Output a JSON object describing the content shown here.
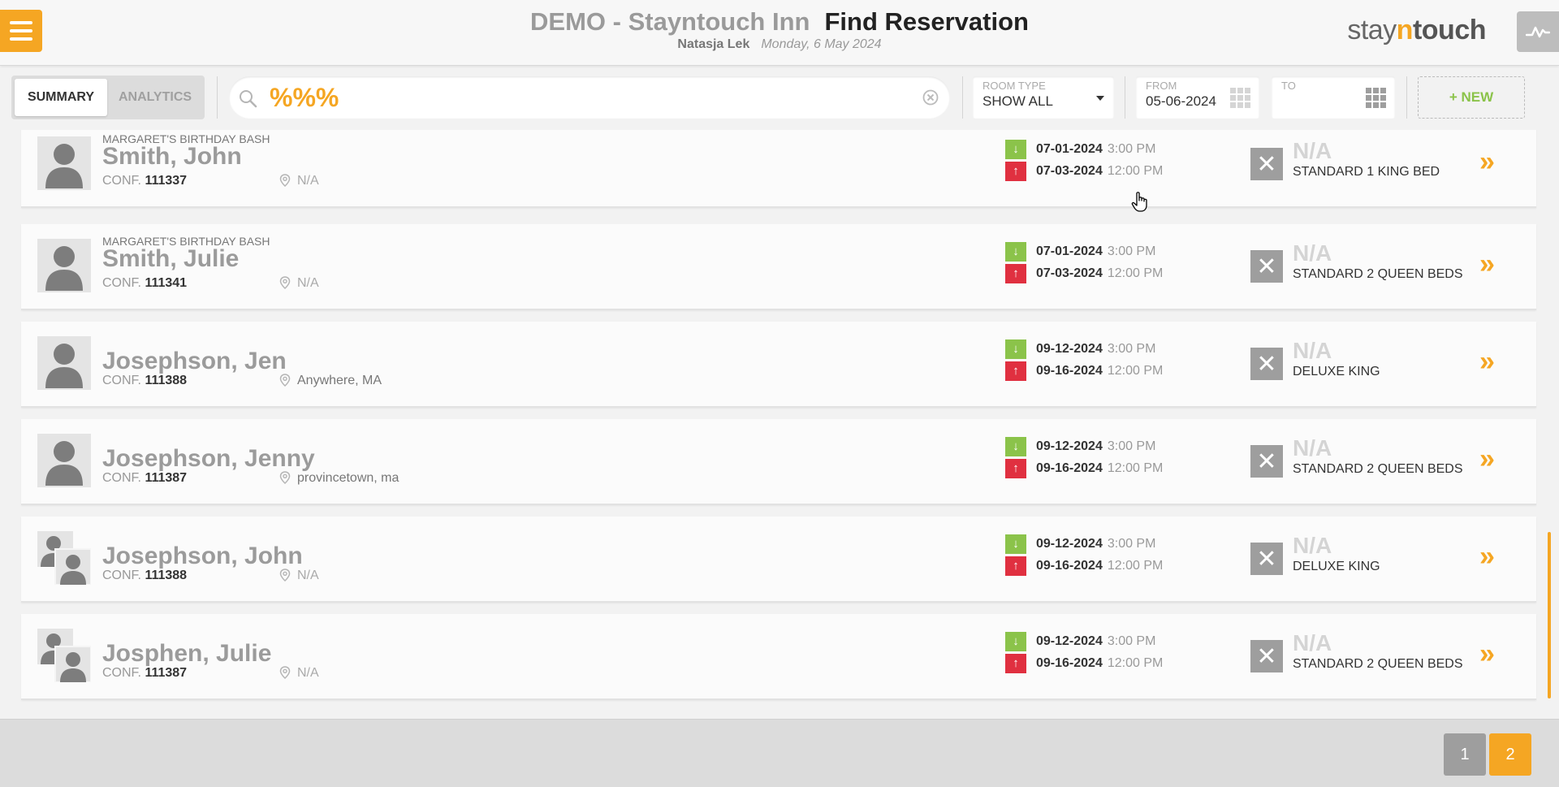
{
  "header": {
    "hotel_name": "DEMO - Stayntouch Inn",
    "page_title": "Find Reservation",
    "user": "Natasja Lek",
    "date": "Monday, 6 May 2024",
    "logo_pre": "stay",
    "logo_n": "n",
    "logo_post": "touch"
  },
  "toolbar": {
    "tabs": [
      {
        "label": "SUMMARY",
        "active": true
      },
      {
        "label": "ANALYTICS",
        "active": false
      }
    ],
    "search_value": "%%%",
    "room_type": {
      "label": "ROOM TYPE",
      "value": "SHOW ALL"
    },
    "from": {
      "label": "FROM",
      "value": "05-06-2024"
    },
    "to": {
      "label": "TO",
      "value": ""
    },
    "new_label": "+ NEW"
  },
  "reservations": [
    {
      "group": "MARGARET'S BIRTHDAY BASH",
      "name": "Smith, John",
      "conf_label": "CONF.",
      "conf": "111337",
      "location": "N/A",
      "arrival_date": "07-01-2024",
      "arrival_time": "3:00 PM",
      "departure_date": "07-03-2024",
      "departure_time": "12:00 PM",
      "room": "N/A",
      "room_type": "STANDARD 1 KING BED",
      "avatar": "single"
    },
    {
      "group": "MARGARET'S BIRTHDAY BASH",
      "name": "Smith, Julie",
      "conf_label": "CONF.",
      "conf": "111341",
      "location": "N/A",
      "arrival_date": "07-01-2024",
      "arrival_time": "3:00 PM",
      "departure_date": "07-03-2024",
      "departure_time": "12:00 PM",
      "room": "N/A",
      "room_type": "STANDARD 2 QUEEN BEDS",
      "avatar": "single"
    },
    {
      "group": "",
      "name": "Josephson, Jen",
      "conf_label": "CONF.",
      "conf": "111388",
      "location": "Anywhere, MA",
      "arrival_date": "09-12-2024",
      "arrival_time": "3:00 PM",
      "departure_date": "09-16-2024",
      "departure_time": "12:00 PM",
      "room": "N/A",
      "room_type": "DELUXE KING",
      "avatar": "single"
    },
    {
      "group": "",
      "name": "Josephson, Jenny",
      "conf_label": "CONF.",
      "conf": "111387",
      "location": "provincetown, ma",
      "arrival_date": "09-12-2024",
      "arrival_time": "3:00 PM",
      "departure_date": "09-16-2024",
      "departure_time": "12:00 PM",
      "room": "N/A",
      "room_type": "STANDARD 2 QUEEN BEDS",
      "avatar": "single"
    },
    {
      "group": "",
      "name": "Josephson, John",
      "conf_label": "CONF.",
      "conf": "111388",
      "location": "N/A",
      "arrival_date": "09-12-2024",
      "arrival_time": "3:00 PM",
      "departure_date": "09-16-2024",
      "departure_time": "12:00 PM",
      "room": "N/A",
      "room_type": "DELUXE KING",
      "avatar": "multiple"
    },
    {
      "group": "",
      "name": "Josphen, Julie",
      "conf_label": "CONF.",
      "conf": "111387",
      "location": "N/A",
      "arrival_date": "09-12-2024",
      "arrival_time": "3:00 PM",
      "departure_date": "09-16-2024",
      "departure_time": "12:00 PM",
      "room": "N/A",
      "room_type": "STANDARD 2 QUEEN BEDS",
      "avatar": "multiple"
    }
  ],
  "pagination": {
    "pages": [
      "1",
      "2"
    ],
    "current": "2"
  },
  "colors": {
    "accent": "#f5a623",
    "arrival": "#8bc34a",
    "departure": "#e03040"
  },
  "icons": {
    "menu": "hamburger-icon",
    "pulse": "activity-icon",
    "search": "search-icon",
    "clear": "clear-circle-icon",
    "calendar": "calendar-grid-icon",
    "location": "map-pin-icon",
    "arrival": "arrow-down-icon",
    "departure": "arrow-up-icon",
    "room_unassigned": "x-icon",
    "open": "double-chevron-right-icon"
  }
}
